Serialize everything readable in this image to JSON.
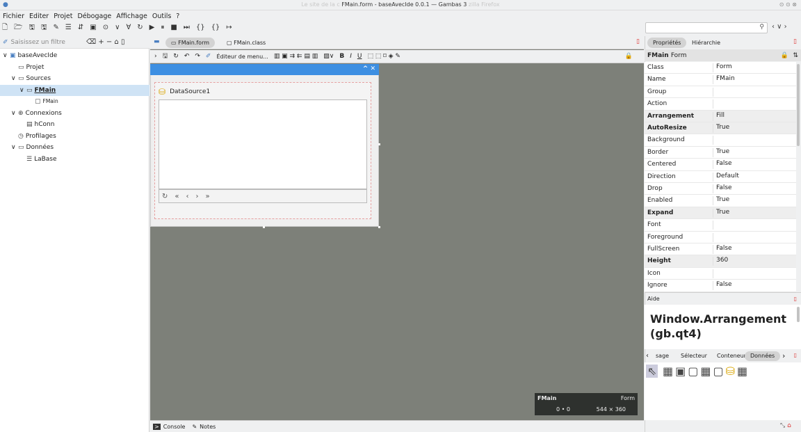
{
  "window": {
    "title": "FMain.form - baseAvecIde 0.0.1 — Gambas 3",
    "title_ghost_left": "Le site de la c",
    "title_ghost_right": "zilla Firefox"
  },
  "menu": [
    "Fichier",
    "Editer",
    "Projet",
    "Débogage",
    "Affichage",
    "Outils",
    "?"
  ],
  "toolbar_icons": [
    "new-icon",
    "open-icon",
    "save-icon",
    "save-as-icon",
    "edit-icon",
    "properties-icon",
    "import-icon",
    "form-icon",
    "record-icon",
    "down-arrow-icon",
    "double-down-icon",
    "refresh-icon",
    "run-icon",
    "pause-icon",
    "stop-icon",
    "step-icon",
    "braces-icon",
    "step-into-icon",
    "step-end-icon"
  ],
  "toolbar_glyphs": [
    "🗋",
    "🗁",
    "🖫",
    "🖫",
    "✎",
    "☰",
    "⇵",
    "▣",
    "⊙",
    "∨",
    "∀",
    "↻",
    "▶",
    "⏸",
    "■",
    "⏭",
    "{}",
    "{}",
    "↦"
  ],
  "left": {
    "filter_placeholder": "Saisissez un filtre",
    "tree": [
      {
        "label": "baseAvecIde",
        "level": 0,
        "exp": "∨",
        "icon": "▣"
      },
      {
        "label": "Projet",
        "level": 1,
        "exp": "",
        "icon": "▭"
      },
      {
        "label": "Sources",
        "level": 1,
        "exp": "∨",
        "icon": "▭"
      },
      {
        "label": "FMain",
        "level": 2,
        "exp": "∨",
        "icon": "▭",
        "sel": true
      },
      {
        "label": "FMain",
        "level": 3,
        "exp": "",
        "icon": "▢"
      },
      {
        "label": "Connexions",
        "level": 1,
        "exp": "∨",
        "icon": "⊕"
      },
      {
        "label": "hConn",
        "level": 2,
        "exp": "",
        "icon": "▤"
      },
      {
        "label": "Profilages",
        "level": 1,
        "exp": "",
        "icon": "◷"
      },
      {
        "label": "Données",
        "level": 1,
        "exp": "∨",
        "icon": "▭"
      },
      {
        "label": "LaBase",
        "level": 2,
        "exp": "",
        "icon": "☰"
      }
    ]
  },
  "tabs": [
    {
      "label": "FMain.form",
      "active": true
    },
    {
      "label": "FMain.class",
      "active": false
    }
  ],
  "form_toolbar": {
    "menu_editor": "Éditeur de menu..."
  },
  "form": {
    "datasource": "DataSource1"
  },
  "info": {
    "name": "FMain",
    "type": "Form",
    "pos": "0 • 0",
    "size": "544 × 360"
  },
  "bottom": {
    "console": "Console",
    "notes": "Notes"
  },
  "right": {
    "tab_props": "Propriétés",
    "tab_hier": "Hiérarchie",
    "object_name": "FMain",
    "object_type": "Form",
    "props": [
      {
        "n": "Class",
        "v": "Form",
        "b": false
      },
      {
        "n": "Name",
        "v": "FMain",
        "b": false
      },
      {
        "n": "Group",
        "v": "",
        "b": false
      },
      {
        "n": "Action",
        "v": "",
        "b": false
      },
      {
        "n": "Arrangement",
        "v": "Fill",
        "b": true
      },
      {
        "n": "AutoResize",
        "v": "True",
        "b": true
      },
      {
        "n": "Background",
        "v": "",
        "b": false
      },
      {
        "n": "Border",
        "v": "True",
        "b": false
      },
      {
        "n": "Centered",
        "v": "False",
        "b": false
      },
      {
        "n": "Direction",
        "v": "Default",
        "b": false
      },
      {
        "n": "Drop",
        "v": "False",
        "b": false
      },
      {
        "n": "Enabled",
        "v": "True",
        "b": false
      },
      {
        "n": "Expand",
        "v": "True",
        "b": true
      },
      {
        "n": "Font",
        "v": "",
        "b": false
      },
      {
        "n": "Foreground",
        "v": "",
        "b": false
      },
      {
        "n": "FullScreen",
        "v": "False",
        "b": false
      },
      {
        "n": "Height",
        "v": "360",
        "b": true
      },
      {
        "n": "Icon",
        "v": "",
        "b": false
      },
      {
        "n": "Ignore",
        "v": "False",
        "b": false
      }
    ],
    "aide_label": "Aide",
    "aide_text": "Window.Arrangement (gb.qt4)",
    "palette_tabs": [
      "sage",
      "Sélecteur",
      "Conteneur",
      "Données"
    ],
    "palette_active": "Données"
  }
}
